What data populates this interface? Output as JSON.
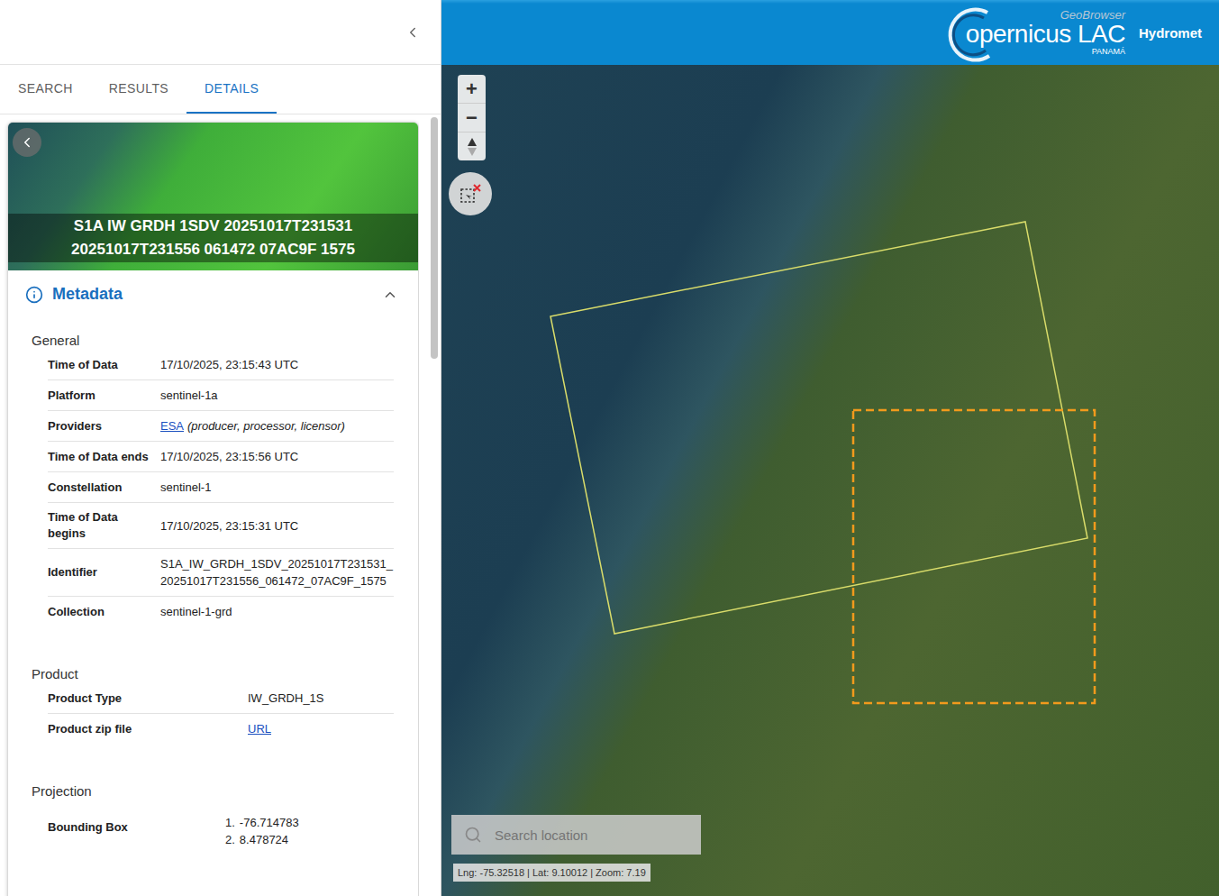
{
  "panel": {
    "tabs": [
      {
        "label": "SEARCH",
        "selected": false
      },
      {
        "label": "RESULTS",
        "selected": false
      },
      {
        "label": "DETAILS",
        "selected": true
      }
    ],
    "scrollbar": {
      "level": 0.31
    },
    "card": {
      "title_lines": [
        "S1A IW GRDH 1SDV 20251017T231531",
        "20251017T231556 061472 07AC9F 1575"
      ]
    },
    "metadata": {
      "title": "Metadata",
      "expanded": true,
      "groups": [
        {
          "title": "General",
          "rows": [
            {
              "kind": "text",
              "label": "Time of Data",
              "value": "17/10/2025, 23:15:43 UTC"
            },
            {
              "kind": "text",
              "label": "Platform",
              "value": "sentinel-1a"
            },
            {
              "kind": "provider",
              "label": "Providers",
              "link": "ESA",
              "note": "(producer, processor, licensor)"
            },
            {
              "kind": "text",
              "label": "Time of Data ends",
              "value": "17/10/2025, 23:15:56 UTC"
            },
            {
              "kind": "text",
              "label": "Constellation",
              "value": "sentinel-1"
            },
            {
              "kind": "text",
              "label": "Time of Data begins",
              "value": "17/10/2025, 23:15:31 UTC"
            },
            {
              "kind": "text",
              "label": "Identifier",
              "value": "S1A_IW_GRDH_1SDV_20251017T231531_20251017T231556_061472_07AC9F_1575"
            },
            {
              "kind": "text",
              "label": "Collection",
              "value": "sentinel-1-grd"
            }
          ]
        },
        {
          "title": "Product",
          "rows": [
            {
              "kind": "text",
              "label": "Product Type",
              "value": "IW_GRDH_1S"
            },
            {
              "kind": "link",
              "label": "Product zip file",
              "value": "URL"
            }
          ]
        },
        {
          "title": "Projection",
          "rows": [
            {
              "kind": "list",
              "label": "Bounding Box",
              "items": [
                {
                  "marker": "1.",
                  "value": "-76.714783"
                },
                {
                  "marker": "2.",
                  "value": "8.478724"
                }
              ]
            }
          ]
        }
      ]
    }
  },
  "map": {
    "brand": {
      "sub": "GeoBrowser",
      "name": "opernicus LAC",
      "region": "PANAMÁ",
      "app": "Hydromet"
    },
    "zoom_in": "+",
    "zoom_out": "−",
    "search": {
      "placeholder": "Search location"
    },
    "status": "Lng: -75.32518 | Lat: 9.10012 | Zoom: 7.19"
  }
}
